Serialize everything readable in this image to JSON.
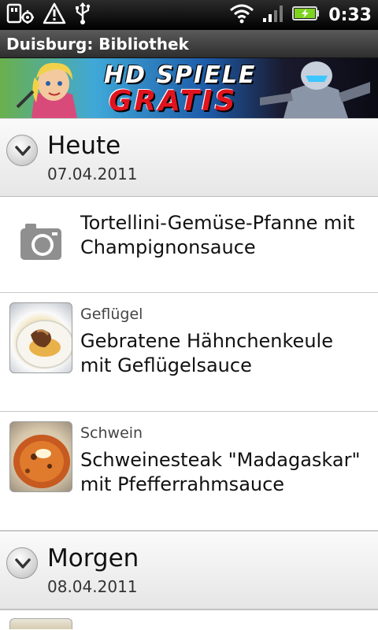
{
  "status_bar": {
    "left_icons": [
      "sd-card-settings-icon",
      "warning-icon",
      "usb-icon"
    ],
    "right_icons": [
      "wifi-icon",
      "signal-icon",
      "battery-charging-icon"
    ],
    "time": "0:33"
  },
  "title_bar": {
    "title": "Duisburg: Bibliothek"
  },
  "banner": {
    "line1": "HD SPIELE",
    "line2": "GRATIS"
  },
  "sections": [
    {
      "title": "Heute",
      "date": "07.04.2011",
      "items": [
        {
          "category": "",
          "name": "Tortellini-Gemüse-Pfanne mit Champignonsauce",
          "icon": "camera-icon"
        },
        {
          "category": "Geflügel",
          "name": "Gebratene Hähnchenkeule mit Geflügelsauce",
          "icon": "food-photo-chicken"
        },
        {
          "category": "Schwein",
          "name": "Schweinesteak \"Madagaskar\" mit Pfefferrahmsauce",
          "icon": "food-photo-pork"
        }
      ]
    },
    {
      "title": "Morgen",
      "date": "08.04.2011",
      "items": []
    }
  ],
  "colors": {
    "status_bar": "#000000",
    "title_bar": "#3d3d3d",
    "section_header": "#ececec",
    "battery_green": "#7ed321"
  }
}
